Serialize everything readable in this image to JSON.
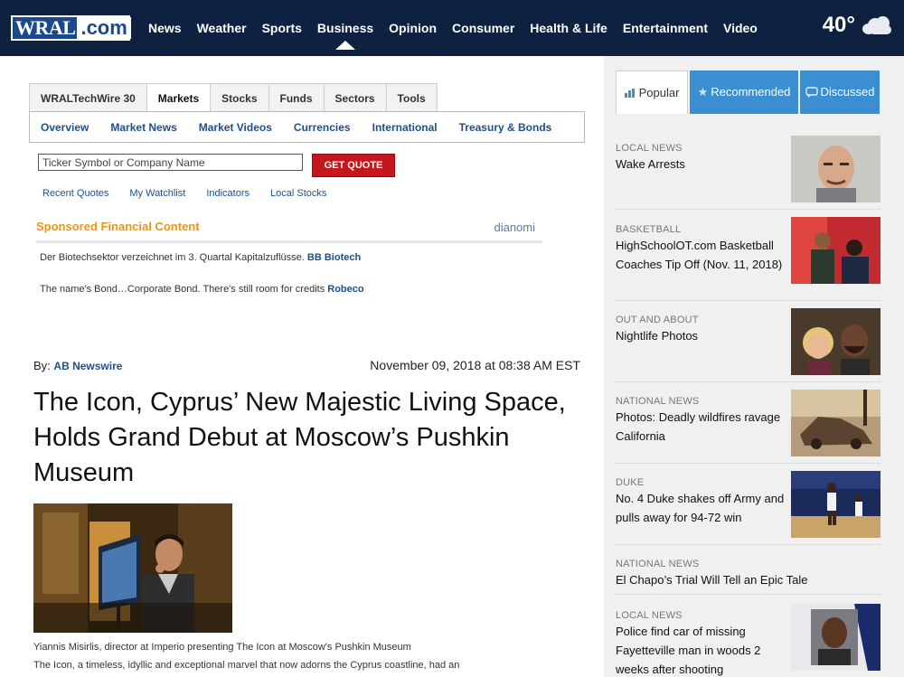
{
  "header": {
    "logo_left": "WRAL",
    "logo_right": ".com",
    "nav": [
      "News",
      "Weather",
      "Sports",
      "Business",
      "Opinion",
      "Consumer",
      "Health & Life",
      "Entertainment",
      "Video"
    ],
    "active_nav": "Business",
    "temperature": "40°",
    "weather_icon": "cloud-icon"
  },
  "markets": {
    "tabs": [
      "WRALTechWire 30",
      "Markets",
      "Stocks",
      "Funds",
      "Sectors",
      "Tools"
    ],
    "active_tab": "Markets",
    "subnav": [
      "Overview",
      "Market News",
      "Market Videos",
      "Currencies",
      "International",
      "Treasury & Bonds"
    ],
    "ticker_placeholder": "Ticker Symbol or Company Name",
    "quote_button": "GET QUOTE",
    "quick_links": [
      "Recent Quotes",
      "My Watchlist",
      "Indicators",
      "Local Stocks"
    ]
  },
  "sponsored": {
    "title": "Sponsored Financial Content",
    "brand": "dianomi",
    "items": [
      {
        "text": "Der Biotechsektor verzeichnet im 3. Quartal Kapitalzuflüsse.",
        "source": "BB Biotech"
      },
      {
        "text": "The name's Bond…Corporate Bond. There's still room for credits",
        "source": "Robeco"
      }
    ]
  },
  "article": {
    "by_label": "By:",
    "author": "AB Newswire",
    "date": "November 09, 2018 at 08:38 AM EST",
    "headline": "The Icon, Cyprus’ New Majestic Living Space, Holds Grand Debut at Moscow’s Pushkin Museum",
    "caption": "Yiannis Misirlis, director at Imperio presenting The Icon at Moscow's Pushkin Museum",
    "body_start": "The Icon, a timeless, idyllic and exceptional marvel that now adorns the Cyprus coastline, had an"
  },
  "sidebar": {
    "tabs": [
      {
        "label": "Popular",
        "icon": "bar-chart-icon"
      },
      {
        "label": "Recommended",
        "icon": "star-icon"
      },
      {
        "label": "Discussed",
        "icon": "speech-bubble-icon"
      }
    ],
    "stories": [
      {
        "category": "LOCAL NEWS",
        "title": "Wake Arrests"
      },
      {
        "category": "BASKETBALL",
        "title": "HighSchoolOT.com Basketball Coaches Tip Off (Nov. 11, 2018)"
      },
      {
        "category": "OUT AND ABOUT",
        "title": "Nightlife Photos"
      },
      {
        "category": "NATIONAL NEWS",
        "title": "Photos: Deadly wildfires ravage California"
      },
      {
        "category": "DUKE",
        "title": "No. 4 Duke shakes off Army and pulls away for 94-72 win"
      },
      {
        "category": "NATIONAL NEWS",
        "title": "El Chapo’s Trial Will Tell an Epic Tale"
      },
      {
        "category": "LOCAL NEWS",
        "title": "Police find car of missing Fayetteville man in woods 2 weeks after shooting"
      }
    ]
  }
}
